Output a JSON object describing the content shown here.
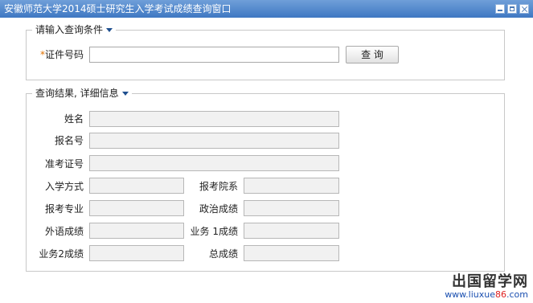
{
  "window": {
    "title": "安徽师范大学2014硕士研究生入学考试成绩查询窗口"
  },
  "query_section": {
    "legend": "请输入查询条件",
    "id_label": "证件号码",
    "required_mark": "*",
    "id_value": "",
    "query_button": "查 询"
  },
  "result_section": {
    "legend": "查询结果, 详细信息",
    "fields": {
      "name": "姓名",
      "reg_no": "报名号",
      "ticket_no": "准考证号",
      "admission_type": "入学方式",
      "applied_dept": "报考院系",
      "applied_major": "报考专业",
      "politics": "政治成绩",
      "foreign_lang": "外语成绩",
      "subject1": "业务 1成绩",
      "subject2": "业务2成绩",
      "total": "总成绩"
    }
  },
  "watermark": {
    "line1": "出国留学网",
    "line2_prefix": "www.liuxue",
    "line2_number": "86",
    "line2_suffix": ".com"
  },
  "colors": {
    "titlebar": "#4a80c8",
    "accent_arrow": "#1f4f8f",
    "required": "#e07000"
  }
}
